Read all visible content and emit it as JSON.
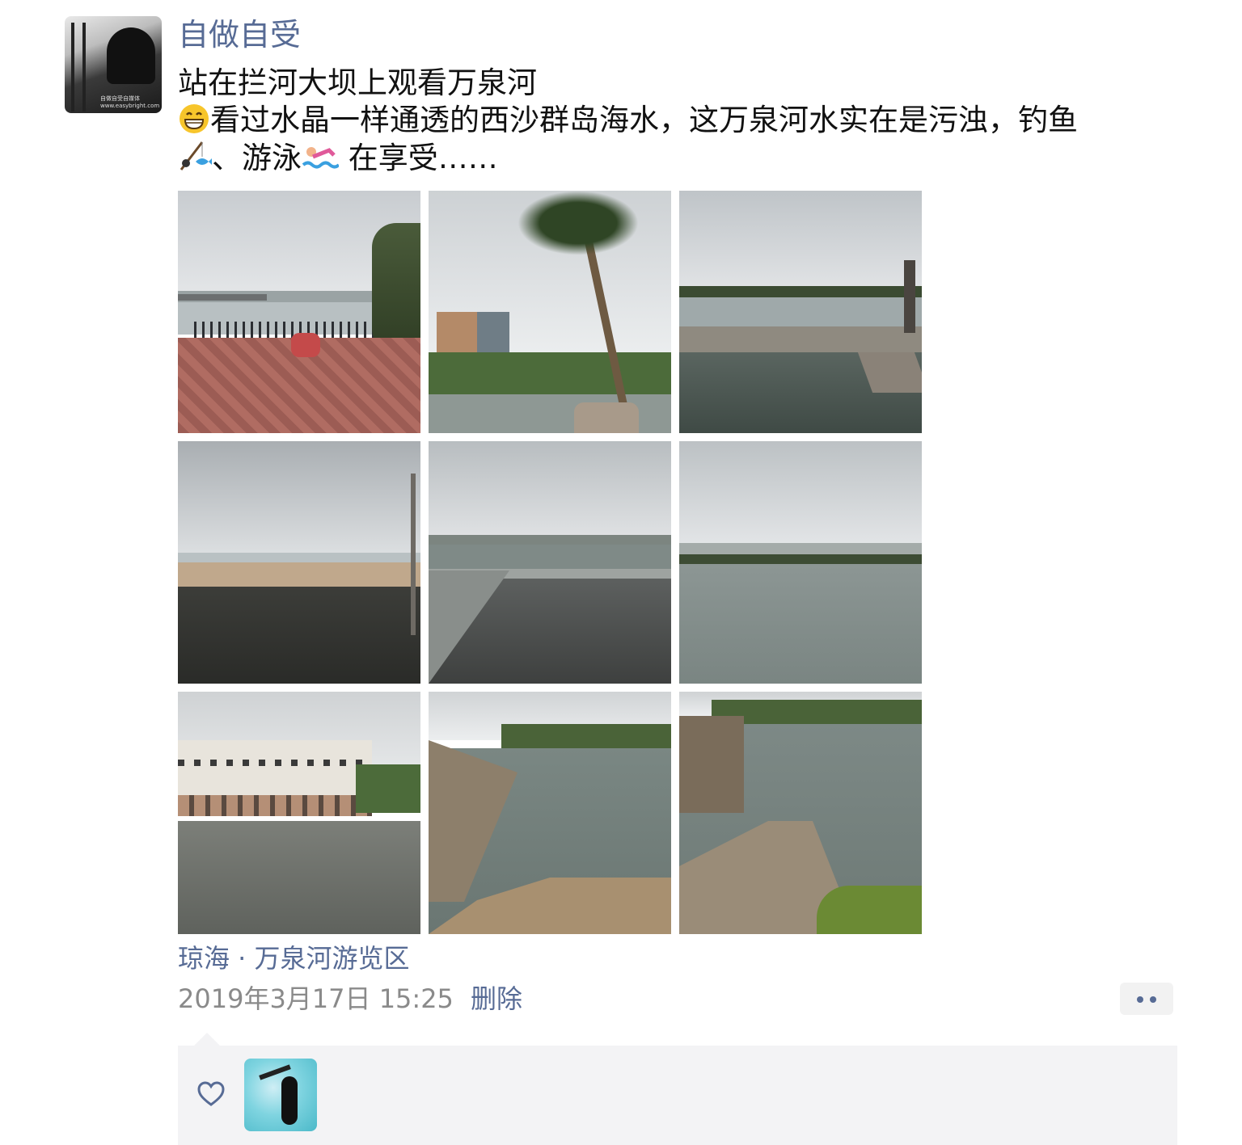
{
  "post": {
    "username": "自做自受",
    "text_line1": "站在拦河大坝上观看万泉河",
    "text_line2": "看过水晶一样通透的西沙群岛海水，这万泉河水实在是污浊，钓鱼",
    "text_line3_a": "、游泳",
    "text_line3_b": " 在享受……",
    "location": "琼海 · 万泉河游览区",
    "timestamp": "2019年3月17日 15:25",
    "delete_label": "删除",
    "photos": [
      {
        "name": "photo-riverside-promenade"
      },
      {
        "name": "photo-coconut-palm"
      },
      {
        "name": "photo-dam-pool"
      },
      {
        "name": "photo-dam-wall"
      },
      {
        "name": "photo-concrete-slope"
      },
      {
        "name": "photo-river-skyline"
      },
      {
        "name": "photo-sluice-building"
      },
      {
        "name": "photo-arched-dam-left"
      },
      {
        "name": "photo-arched-dam-right"
      }
    ]
  },
  "icons": {
    "grin": "grinning-face-icon",
    "fishing": "fishing-pole-icon",
    "swimmer": "swimmer-icon",
    "more": "more-icon",
    "like": "heart-icon"
  },
  "colors": {
    "link_blue": "#576b95",
    "timestamp_gray": "#8a8a8a",
    "likes_bg": "#f3f3f5"
  }
}
